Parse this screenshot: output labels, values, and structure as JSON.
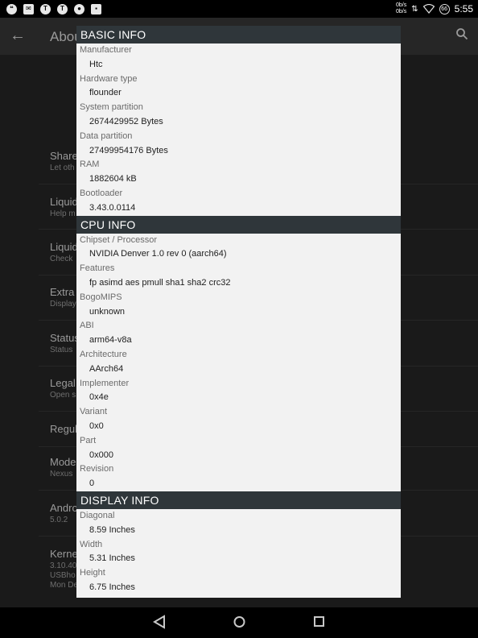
{
  "status_bar": {
    "notification_icons": [
      "hangouts-icon",
      "mail-icon",
      "t-icon",
      "t-icon",
      "circle-app-icon",
      "image-icon"
    ],
    "net_speed_up": "0b/s",
    "net_speed_down": "0b/s",
    "battery_label": "66",
    "time": "5:55"
  },
  "app_bar": {
    "title": "Abou"
  },
  "background_list": [
    {
      "title": "Share",
      "subtitle": "Let oth"
    },
    {
      "title": "Liquid",
      "subtitle": "Help m"
    },
    {
      "title": "Liquid",
      "subtitle": "Check"
    },
    {
      "title": "Extra i",
      "subtitle": "Display"
    },
    {
      "title": "Status",
      "subtitle": "Status"
    },
    {
      "title": "Legal",
      "subtitle": "Open s"
    },
    {
      "title": "Regula",
      "subtitle": ""
    },
    {
      "title": "Model",
      "subtitle": "Nexus"
    },
    {
      "title": "Andro",
      "subtitle": "5.0.2"
    },
    {
      "title": "Kerne",
      "subtitle": "3.10.40\nUSBho\nMon De"
    }
  ],
  "dialog": {
    "sections": [
      {
        "header": "BASIC INFO",
        "items": [
          {
            "label": "Manufacturer",
            "value": "Htc"
          },
          {
            "label": "Hardware type",
            "value": "flounder"
          },
          {
            "label": "System partition",
            "value": "2674429952 Bytes"
          },
          {
            "label": "Data partition",
            "value": "27499954176 Bytes"
          },
          {
            "label": "RAM",
            "value": "1882604 kB"
          },
          {
            "label": "Bootloader",
            "value": "3.43.0.0114"
          }
        ]
      },
      {
        "header": "CPU INFO",
        "items": [
          {
            "label": "Chipset / Processor",
            "value": "NVIDIA Denver 1.0 rev 0 (aarch64)"
          },
          {
            "label": "Features",
            "value": "fp asimd aes pmull sha1 sha2 crc32"
          },
          {
            "label": "BogoMIPS",
            "value": "unknown"
          },
          {
            "label": "ABI",
            "value": "arm64-v8a"
          },
          {
            "label": "Architecture",
            "value": "AArch64"
          },
          {
            "label": "Implementer",
            "value": "0x4e"
          },
          {
            "label": "Variant",
            "value": "0x0"
          },
          {
            "label": "Part",
            "value": "0x000"
          },
          {
            "label": "Revision",
            "value": "0"
          }
        ]
      },
      {
        "header": "DISPLAY INFO",
        "items": [
          {
            "label": "Diagonal",
            "value": "8.59 Inches"
          },
          {
            "label": "Width",
            "value": "5.31 Inches"
          },
          {
            "label": "Height",
            "value": "6.75 Inches"
          }
        ]
      }
    ]
  },
  "nav_bar": {
    "buttons": [
      "back-icon",
      "home-icon",
      "recents-icon"
    ]
  }
}
